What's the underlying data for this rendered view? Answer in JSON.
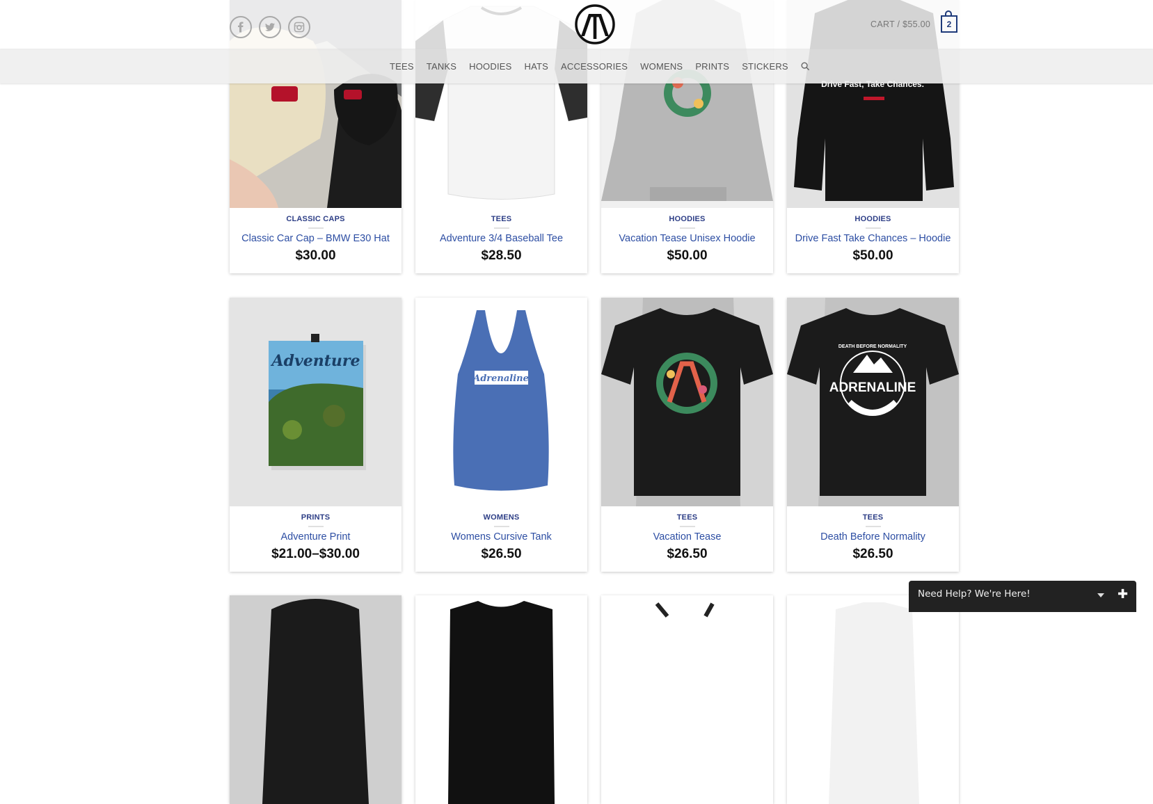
{
  "header": {
    "social": [
      {
        "name": "facebook-icon"
      },
      {
        "name": "twitter-icon"
      },
      {
        "name": "instagram-icon"
      }
    ],
    "logo_text": "ATA",
    "cart_label": "CART / $55.00",
    "cart_count": "2",
    "accent_color": "#1e3a7a"
  },
  "nav": {
    "items": [
      "TEES",
      "TANKS",
      "HOODIES",
      "HATS",
      "ACCESSORIES",
      "WOMENS",
      "PRINTS",
      "STICKERS"
    ],
    "search_icon": "search-icon"
  },
  "products": [
    {
      "category": "CLASSIC CAPS",
      "title": "Classic Car Cap – BMW E30 Hat",
      "price": "$30.00"
    },
    {
      "category": "TEES",
      "title": "Adventure 3/4 Baseball Tee",
      "price": "$28.50"
    },
    {
      "category": "HOODIES",
      "title": "Vacation Tease Unisex Hoodie",
      "price": "$50.00"
    },
    {
      "category": "HOODIES",
      "title": "Drive Fast Take Chances – Hoodie",
      "price": "$50.00"
    },
    {
      "category": "PRINTS",
      "title": "Adventure Print",
      "price": "$21.00–$30.00"
    },
    {
      "category": "WOMENS",
      "title": "Womens Cursive Tank",
      "price": "$26.50"
    },
    {
      "category": "TEES",
      "title": "Vacation Tease",
      "price": "$26.50"
    },
    {
      "category": "TEES",
      "title": "Death Before Normality",
      "price": "$26.50"
    }
  ],
  "product_images": {
    "hoodie_print": "Drive Fast, Take Chances.",
    "poster_print": "Adventure",
    "tank_print": "Adrenaline",
    "tee_print_top": "DEATH BEFORE NORMALITY",
    "tee_print_main": "ADRENALINE"
  },
  "chat": {
    "label": "Need Help? We're Here!"
  }
}
